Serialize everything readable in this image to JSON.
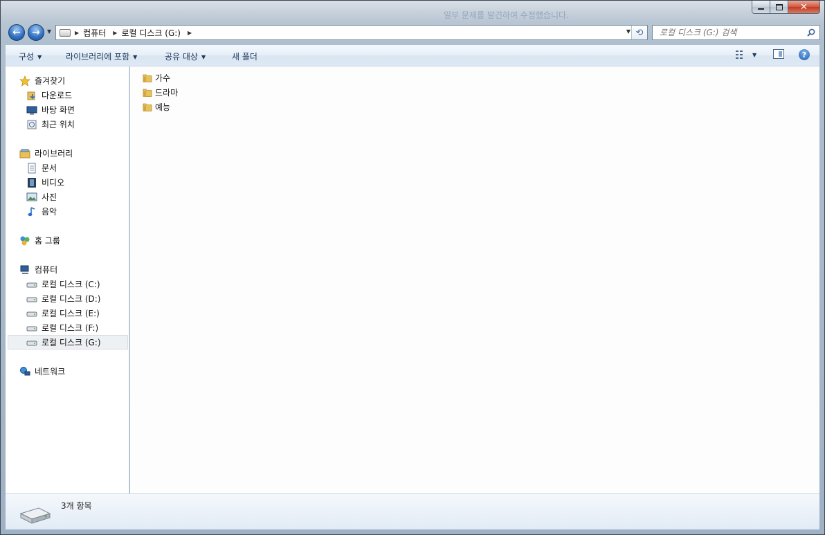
{
  "titlebar": {
    "background_text": "일부 문제를 발견하여 수정했습니다."
  },
  "nav": {
    "back_icon": "back-arrow-icon",
    "forward_icon": "forward-arrow-icon"
  },
  "address": {
    "crumbs": [
      "컴퓨터",
      "로컬 디스크 (G:)"
    ]
  },
  "search": {
    "placeholder": "로컬 디스크 (G:) 검색"
  },
  "toolbar": {
    "organize": "구성",
    "include_library": "라이브러리에 포함",
    "share_with": "공유 대상",
    "new_folder": "새 폴더"
  },
  "sidebar": {
    "favorites": {
      "label": "즐겨찾기",
      "items": [
        "다운로드",
        "바탕 화면",
        "최근 위치"
      ]
    },
    "libraries": {
      "label": "라이브러리",
      "items": [
        "문서",
        "비디오",
        "사진",
        "음악"
      ]
    },
    "homegroup": {
      "label": "홈 그룹"
    },
    "computer": {
      "label": "컴퓨터",
      "drives": [
        "로컬 디스크 (C:)",
        "로컬 디스크 (D:)",
        "로컬 디스크 (E:)",
        "로컬 디스크 (F:)",
        "로컬 디스크 (G:)"
      ],
      "selected": "로컬 디스크 (G:)"
    },
    "network": {
      "label": "네트워크"
    }
  },
  "files": [
    "가수",
    "드라마",
    "예능"
  ],
  "status": {
    "item_count": "3개 항목"
  },
  "colors": {
    "accent": "#1e395b",
    "folder": "#e8c15a",
    "selection": "#eef1f4"
  }
}
